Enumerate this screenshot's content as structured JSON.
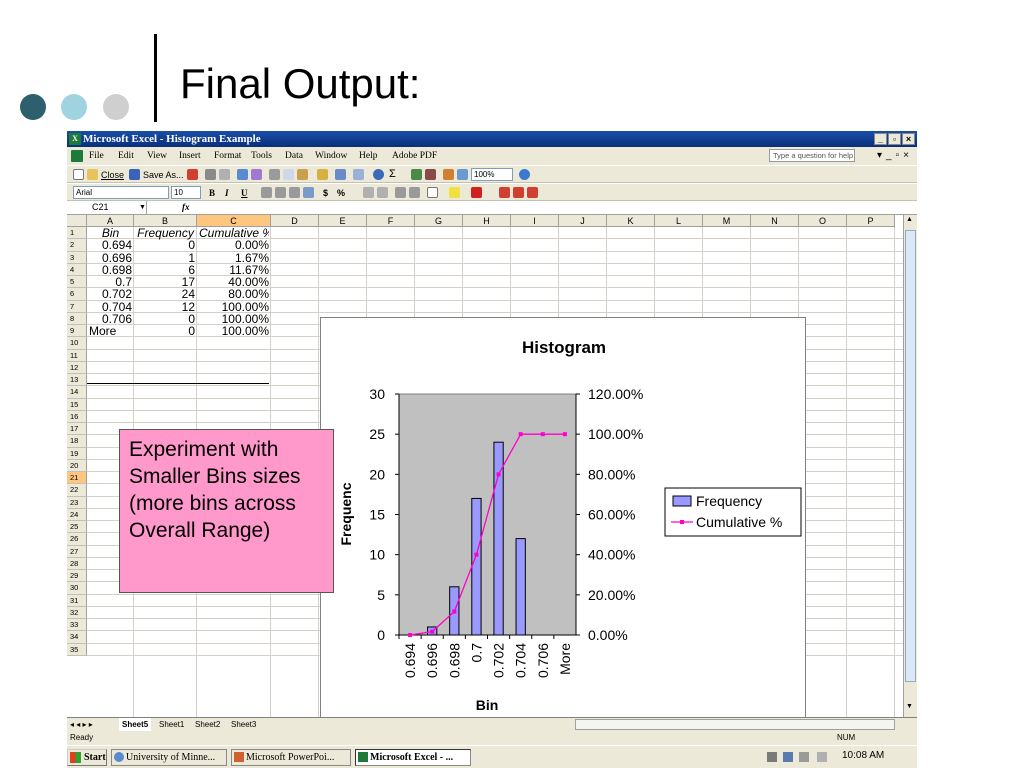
{
  "slide": {
    "title": "Final Output:",
    "dots": [
      "#2d5f6c",
      "#9fd3df",
      "#cfcfcf"
    ]
  },
  "excel": {
    "window_title": "Microsoft Excel - Histogram Example",
    "menu": [
      "File",
      "Edit",
      "View",
      "Insert",
      "Format",
      "Tools",
      "Data",
      "Window",
      "Help",
      "Adobe PDF"
    ],
    "help_placeholder": "Type a question for help",
    "toolbar": {
      "close_label": "Close",
      "save_as_label": "Save As...",
      "zoom": "100%",
      "font_name": "Arial",
      "font_size": "10",
      "bold": "B",
      "italic": "I",
      "underline": "U",
      "currency": "$",
      "percent": "%"
    },
    "name_box": "C21",
    "fx": "fx",
    "columns": [
      "A",
      "B",
      "C",
      "D",
      "E",
      "F",
      "G",
      "H",
      "I",
      "J",
      "K",
      "L",
      "M",
      "N",
      "O",
      "P"
    ],
    "rows": [
      "1",
      "2",
      "3",
      "4",
      "5",
      "6",
      "7",
      "8",
      "9",
      "10",
      "11",
      "12",
      "13",
      "14",
      "15",
      "16",
      "17",
      "18",
      "19",
      "20",
      "21",
      "22",
      "23",
      "24",
      "25",
      "26",
      "27",
      "28",
      "29",
      "30",
      "31",
      "32",
      "33",
      "34",
      "35"
    ],
    "table": {
      "headers": [
        "Bin",
        "Frequency",
        "Cumulative %"
      ],
      "rows": [
        [
          "0.694",
          "0",
          "0.00%"
        ],
        [
          "0.696",
          "1",
          "1.67%"
        ],
        [
          "0.698",
          "6",
          "11.67%"
        ],
        [
          "0.7",
          "17",
          "40.00%"
        ],
        [
          "0.702",
          "24",
          "80.00%"
        ],
        [
          "0.704",
          "12",
          "100.00%"
        ],
        [
          "0.706",
          "0",
          "100.00%"
        ],
        [
          "More",
          "0",
          "100.00%"
        ]
      ]
    },
    "sheet_tabs": [
      "Sheet5",
      "Sheet1",
      "Sheet2",
      "Sheet3"
    ],
    "status": "Ready",
    "status_num": "NUM",
    "taskbar": {
      "start": "Start",
      "tasks": [
        "University of Minne...",
        "Microsoft PowerPoi...",
        "Microsoft Excel - ..."
      ],
      "clock": "10:08 AM"
    }
  },
  "note_text": "Experiment with Smaller Bins sizes (more bins across Overall Range)",
  "chart_data": {
    "type": "bar",
    "title": "Histogram",
    "xlabel": "Bin",
    "ylabel": "Frequenc",
    "categories": [
      "0.694",
      "0.696",
      "0.698",
      "0.7",
      "0.702",
      "0.704",
      "0.706",
      "More"
    ],
    "series": [
      {
        "name": "Frequency",
        "type": "bar",
        "axis": "left",
        "color": "#9999ff",
        "values": [
          0,
          1,
          6,
          17,
          24,
          12,
          0,
          0
        ]
      },
      {
        "name": "Cumulative %",
        "type": "line",
        "axis": "right",
        "color": "#ff00cc",
        "values": [
          0.0,
          1.67,
          11.67,
          40.0,
          80.0,
          100.0,
          100.0,
          100.0
        ]
      }
    ],
    "ylim": [
      0,
      30
    ],
    "yticks": [
      "0",
      "5",
      "10",
      "15",
      "20",
      "25",
      "30"
    ],
    "y2lim": [
      0,
      120
    ],
    "y2ticks": [
      "0.00%",
      "20.00%",
      "40.00%",
      "60.00%",
      "80.00%",
      "100.00%",
      "120.00%"
    ],
    "legend": "right",
    "plot_background": "#c0c0c0"
  }
}
